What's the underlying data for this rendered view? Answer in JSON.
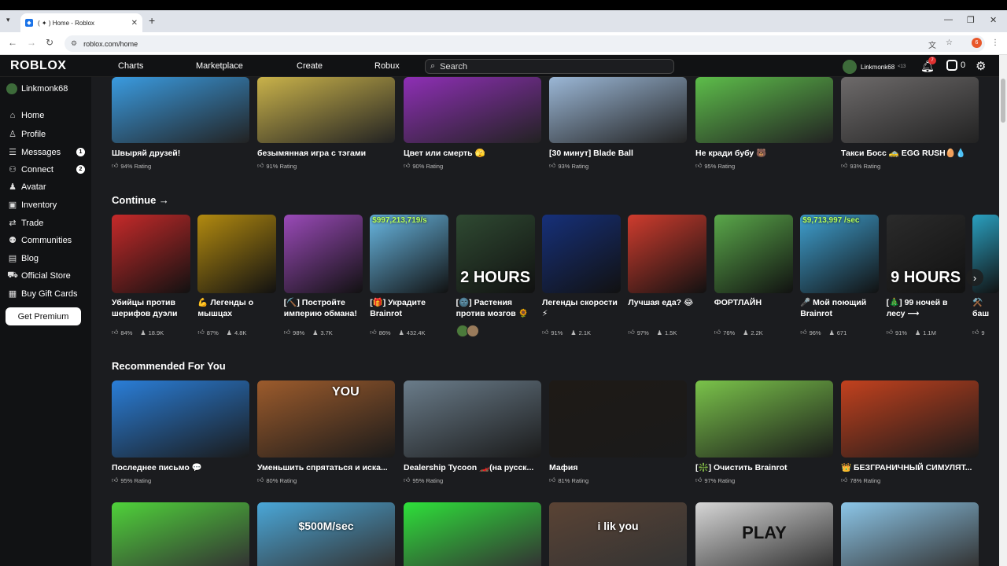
{
  "browser": {
    "tab_title": "( ✦ ) Home - Roblox",
    "url": "roblox.com/home",
    "profile_initial": "6"
  },
  "header": {
    "logo": "ROBLOX",
    "nav": [
      "Charts",
      "Marketplace",
      "Create",
      "Robux"
    ],
    "search_placeholder": "Search",
    "username": "Linkmonk68",
    "age_label": "<13",
    "notifications": "7",
    "robux": "0"
  },
  "sidebar": {
    "username": "Linkmonk68",
    "items": [
      {
        "label": "Home",
        "icon": "home-icon",
        "glyph": "⌂",
        "badge": ""
      },
      {
        "label": "Profile",
        "icon": "profile-icon",
        "glyph": "♙",
        "badge": ""
      },
      {
        "label": "Messages",
        "icon": "messages-icon",
        "glyph": "☰",
        "badge": "1"
      },
      {
        "label": "Connect",
        "icon": "connect-icon",
        "glyph": "⚇",
        "badge": "2"
      },
      {
        "label": "Avatar",
        "icon": "avatar-icon",
        "glyph": "♟",
        "badge": ""
      },
      {
        "label": "Inventory",
        "icon": "inventory-icon",
        "glyph": "▣",
        "badge": ""
      },
      {
        "label": "Trade",
        "icon": "trade-icon",
        "glyph": "⇄",
        "badge": ""
      },
      {
        "label": "Communities",
        "icon": "communities-icon",
        "glyph": "⚉",
        "badge": ""
      },
      {
        "label": "Blog",
        "icon": "blog-icon",
        "glyph": "▤",
        "badge": ""
      },
      {
        "label": "Official Store",
        "icon": "store-icon",
        "glyph": "⛟",
        "badge": ""
      },
      {
        "label": "Buy Gift Cards",
        "icon": "gift-card-icon",
        "glyph": "▦",
        "badge": ""
      }
    ],
    "premium_button": "Get Premium"
  },
  "top_row": [
    {
      "title": "Швыряй друзей!",
      "rating": "94% Rating",
      "color": "#3a9be0"
    },
    {
      "title": "безымянная игра с тэгами",
      "rating": "91% Rating",
      "color": "#c9b24a"
    },
    {
      "title": "Цвет или смерть 🫣",
      "rating": "90% Rating",
      "color": "#8e2fb5"
    },
    {
      "title": "[30 минут] Blade Ball",
      "rating": "93% Rating",
      "color": "#9bb7d6"
    },
    {
      "title": "Не кради бубу 🐻",
      "rating": "95% Rating",
      "color": "#5dbd4a"
    },
    {
      "title": "Такси Босс 🚕 EGG RUSH🥚💧",
      "rating": "93% Rating",
      "color": "#6d6a6a"
    }
  ],
  "continue": {
    "heading": "Continue →",
    "items": [
      {
        "title": "Убийцы против шерифов дуэли",
        "rating": "84%",
        "players": "18.9K",
        "color": "#c62a2a",
        "overlay": ""
      },
      {
        "title": "💪 Легенды о мышцах",
        "rating": "87%",
        "players": "4.8K",
        "color": "#b28a10",
        "overlay": ""
      },
      {
        "title": "[⛏️] Постройте империю обмана!",
        "rating": "98%",
        "players": "3.7K",
        "color": "#9a4ab8",
        "overlay": ""
      },
      {
        "title": "[🎁] Украдите Brainrot",
        "rating": "86%",
        "players": "432.4K",
        "color": "#68b7e2",
        "overlay": "$997,213,719/s"
      },
      {
        "title": "[🌚] Растения против мозгов 🌻",
        "rating": "",
        "players": "",
        "color": "#2f4a32",
        "overlay": "2 HOURS"
      },
      {
        "title": "Легенды скорости ⚡",
        "rating": "91%",
        "players": "2.1K",
        "color": "#16307a",
        "overlay": ""
      },
      {
        "title": "Лучшая еда? 😂",
        "rating": "97%",
        "players": "1.5K",
        "color": "#cf3c2e",
        "overlay": ""
      },
      {
        "title": "ФОРТЛАЙН",
        "rating": "76%",
        "players": "2.2K",
        "color": "#5aa84a",
        "overlay": ""
      },
      {
        "title": "🎤 Мой поющий Brainrot",
        "rating": "96%",
        "players": "671",
        "color": "#3fa0d0",
        "overlay": "$9,713,997 /sec"
      },
      {
        "title": "[🎄] 99 ночей в лесу ⟶",
        "rating": "91%",
        "players": "1.1M",
        "color": "#2b2b2b",
        "overlay": "9 HOURS"
      },
      {
        "title": "⚒️ баш",
        "rating": "9",
        "players": "",
        "color": "#2aa0c0",
        "overlay": ""
      }
    ]
  },
  "recommended": {
    "heading": "Recommended For You",
    "items": [
      {
        "title": "Последнее письмо 💬",
        "rating": "95% Rating",
        "color": "#2a7ed8"
      },
      {
        "title": "Уменьшить спрятаться и иска...",
        "rating": "80% Rating",
        "color": "#9c5b2c",
        "overlay": "YOU"
      },
      {
        "title": "Dealership Tycoon 🏎️(на русск...",
        "rating": "95% Rating",
        "color": "#6a7c8a"
      },
      {
        "title": "Мафия",
        "rating": "81% Rating",
        "color": "#1e1a16"
      },
      {
        "title": "[❇️] Очистить Brainrot",
        "rating": "97% Rating",
        "color": "#7ac34a"
      },
      {
        "title": "👑 БЕЗГРАНИЧНЫЙ СИМУЛЯТ...",
        "rating": "78% Rating",
        "color": "#c2411e"
      }
    ]
  },
  "bottom_row": [
    {
      "color": "#4fd23a",
      "overlay": ""
    },
    {
      "color": "#4aa7d8",
      "overlay": "$500M/sec"
    },
    {
      "color": "#2ee03a",
      "overlay": ""
    },
    {
      "color": "#5a4334",
      "overlay": "i lik you"
    },
    {
      "color": "#d6d6d6",
      "overlay": "PLAY"
    },
    {
      "color": "#8cc6e8",
      "overlay": ""
    }
  ]
}
